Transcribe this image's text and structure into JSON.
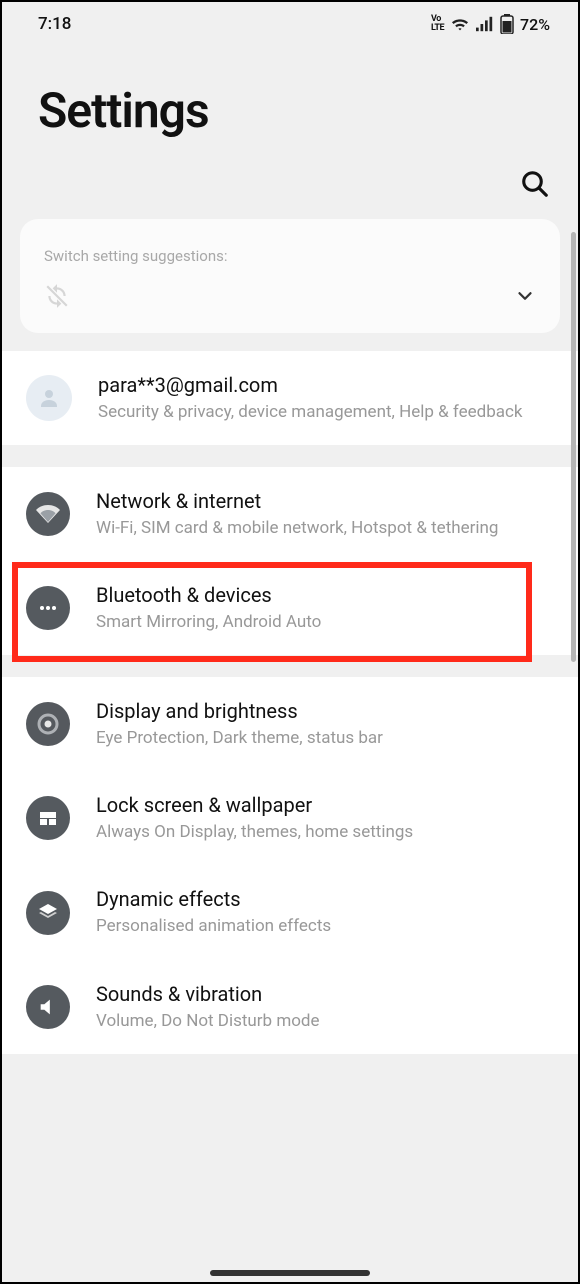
{
  "status": {
    "time": "7:18",
    "volte": "VoLTE",
    "battery_pct": "72%"
  },
  "page_title": "Settings",
  "suggestions": {
    "label": "Switch setting suggestions:"
  },
  "account": {
    "email": "para**3@gmail.com",
    "sub": "Security & privacy, device management, Help & feedback"
  },
  "items": [
    {
      "title": "Network & internet",
      "sub": "Wi-Fi, SIM card & mobile network, Hotspot & tethering"
    },
    {
      "title": "Bluetooth & devices",
      "sub": "Smart Mirroring, Android Auto"
    },
    {
      "title": "Display and brightness",
      "sub": "Eye Protection, Dark theme, status bar"
    },
    {
      "title": "Lock screen & wallpaper",
      "sub": "Always On Display, themes, home settings"
    },
    {
      "title": "Dynamic effects",
      "sub": "Personalised animation effects"
    },
    {
      "title": "Sounds & vibration",
      "sub": "Volume, Do Not Disturb mode"
    }
  ]
}
